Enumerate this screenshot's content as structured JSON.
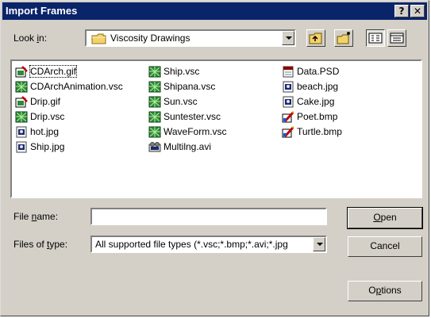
{
  "dialog": {
    "title": "Import Frames"
  },
  "titlebar": {
    "help": "?",
    "close": "✕"
  },
  "look_in": {
    "label_prefix": "Look ",
    "label_accel": "i",
    "label_suffix": "n:",
    "value": "Viscosity Drawings"
  },
  "files": {
    "col1": [
      {
        "name": "CDArch.gif",
        "icon": "gif-image-icon",
        "selected": true
      },
      {
        "name": "CDArchAnimation.vsc",
        "icon": "vsc-file-icon"
      },
      {
        "name": "Drip.gif",
        "icon": "gif-image-icon"
      },
      {
        "name": "Drip.vsc",
        "icon": "vsc-file-icon"
      },
      {
        "name": "hot.jpg",
        "icon": "jpg-image-icon"
      },
      {
        "name": "Ship.jpg",
        "icon": "jpg-image-icon"
      }
    ],
    "col2": [
      {
        "name": "Ship.vsc",
        "icon": "vsc-file-icon"
      },
      {
        "name": "Shipana.vsc",
        "icon": "vsc-file-icon"
      },
      {
        "name": "Sun.vsc",
        "icon": "vsc-file-icon"
      },
      {
        "name": "Suntester.vsc",
        "icon": "vsc-file-icon"
      },
      {
        "name": "WaveForm.vsc",
        "icon": "vsc-file-icon"
      },
      {
        "name": "Multilng.avi",
        "icon": "avi-video-icon"
      }
    ],
    "col3": [
      {
        "name": "Data.PSD",
        "icon": "psd-file-icon"
      },
      {
        "name": "beach.jpg",
        "icon": "jpg-image-icon"
      },
      {
        "name": "Cake.jpg",
        "icon": "jpg-image-icon"
      },
      {
        "name": "Poet.bmp",
        "icon": "bmp-paint-icon"
      },
      {
        "name": "Turtle.bmp",
        "icon": "bmp-paint-icon"
      }
    ]
  },
  "file_name": {
    "label_prefix": "File ",
    "label_accel": "n",
    "label_suffix": "ame:",
    "value": ""
  },
  "file_type": {
    "label_prefix": "Files of ",
    "label_accel": "t",
    "label_suffix": "ype:",
    "value": "All supported file types (*.vsc;*.bmp;*.avi;*.jpg"
  },
  "buttons": {
    "open_accel": "O",
    "open_rest": "pen",
    "cancel": "Cancel",
    "options_prefix": "O",
    "options_accel": "p",
    "options_rest": "tions"
  },
  "colors": {
    "titlebar": "#0a246a",
    "face": "#d4d0c8",
    "folder": "#f2d36b"
  }
}
